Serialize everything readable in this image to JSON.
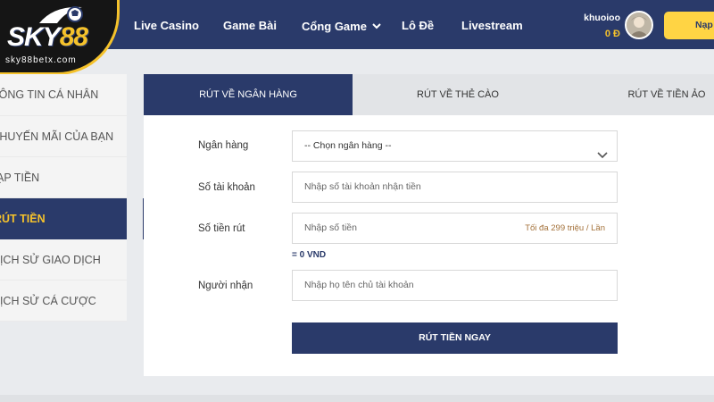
{
  "logo": {
    "brand": "SKY",
    "brand_num": "88",
    "site": "sky88betx.com"
  },
  "nav": {
    "items": [
      "Live Casino",
      "Game Bài",
      "Cổng Game",
      "Lô Đề",
      "Livestream"
    ]
  },
  "user": {
    "name": "khuoioo",
    "balance": "0 Đ",
    "deposit_label": "Nạp"
  },
  "sidebar": {
    "items": [
      "Thông tin cá nhân",
      "Khuyến mãi của bạn",
      "Nạp tiền",
      "Rút tiền",
      "Lịch sử giao dịch",
      "Lịch sử cá cược"
    ],
    "active_index": 3
  },
  "tabs": [
    "Rút về ngân hàng",
    "Rút về thẻ cào",
    "Rút về tiền ảo"
  ],
  "form": {
    "bank_label": "Ngân hàng",
    "bank_value": "-- Chọn ngân hàng --",
    "account_label": "Số tài khoản",
    "account_placeholder": "Nhập số tài khoản nhận tiền",
    "amount_label": "Số tiền rút",
    "amount_placeholder": "Nhập số tiền",
    "amount_hint": "Tối đa 299 triệu / Lần",
    "conversion": "= 0 VND",
    "receiver_label": "Người nhận",
    "receiver_placeholder": "Nhập họ tên chủ tài khoản",
    "submit_label": "Rút tiền ngay"
  },
  "colors": {
    "primary": "#2a3a6a",
    "accent": "#f5c22b",
    "button_yellow": "#ffd444"
  }
}
